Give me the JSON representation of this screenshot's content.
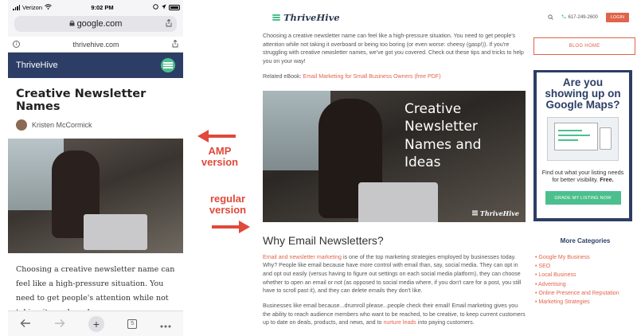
{
  "phone": {
    "status": {
      "carrier": "Verizon",
      "time": "9:02 PM"
    },
    "browser": {
      "url": "google.com"
    },
    "amp_header": {
      "domain": "thrivehive.com"
    },
    "brand": {
      "name": "ThriveHive"
    },
    "article": {
      "title": "Creative Newsletter Names",
      "author": "Kristen McCormick",
      "body": "Choosing a creative newsletter name can feel like a high-pressure situation. You need to get people's attention while not taking it overboard"
    },
    "toolbar": {
      "tab_count": "5"
    }
  },
  "annotations": {
    "amp_label": "AMP version",
    "regular_label": "regular version",
    "color": "#e0493b"
  },
  "desktop": {
    "brand": "ThriveHive",
    "phone_number": "617-249-2600",
    "login": "LOGIN",
    "intro": "Choosing a creative newsletter name can feel like a high-pressure situation. You need to get people's attention while not taking it overboard or being too boring (or even worse: cheesy (gasp!)). If you're struggling with creative newsletter names, we've got you covered. Check out these tips and tricks to help you on your way!",
    "related_prefix": "Related eBook:",
    "related_link": "Email Marketing for Small Business Owners (free PDF)",
    "hero_overlay": [
      "Creative",
      "Newsletter",
      "Names and",
      "Ideas"
    ],
    "hero_watermark": "ThriveHive",
    "section_heading": "Why Email Newsletters?",
    "p2_link": "Email and newsletter marketing",
    "p2_rest": " is one of the top marketing strategies employed by businesses today. Why? People like email because have more control with email than, say, social media. They can opt in and opt out easily (versus having to figure out settings on each social media platform), they can choose whether to open an email or not (as opposed to social media where, if you don't care for a post, you still have to scroll past it), and they can delete emails they don't like.",
    "p3_start": "Businesses like email because...drumroll please...people check their email! Email marketing gives you the ability to reach audience members who want to be reached, to be creative, to keep current customers up to date on deals, products, and news, and to ",
    "p3_link": "nurture leads",
    "p3_end": " into paying customers.",
    "sidebar": {
      "blog_home": "BLOG HOME",
      "ad_title": "Are you showing up on Google Maps?",
      "ad_text": "Find out what your listing needs for better visibility.",
      "ad_text_bold": "Free.",
      "ad_button": "GRADE MY LISTING NOW",
      "more_heading": "More Categories",
      "categories": [
        "Google My Business",
        "SEO",
        "Local Business",
        "Advertising",
        "Online Presence and Reputation",
        "Marketing Strategies"
      ]
    },
    "accent_color": "#e0644b",
    "brand_color": "#2c3e66",
    "green_color": "#4dbf8f"
  }
}
